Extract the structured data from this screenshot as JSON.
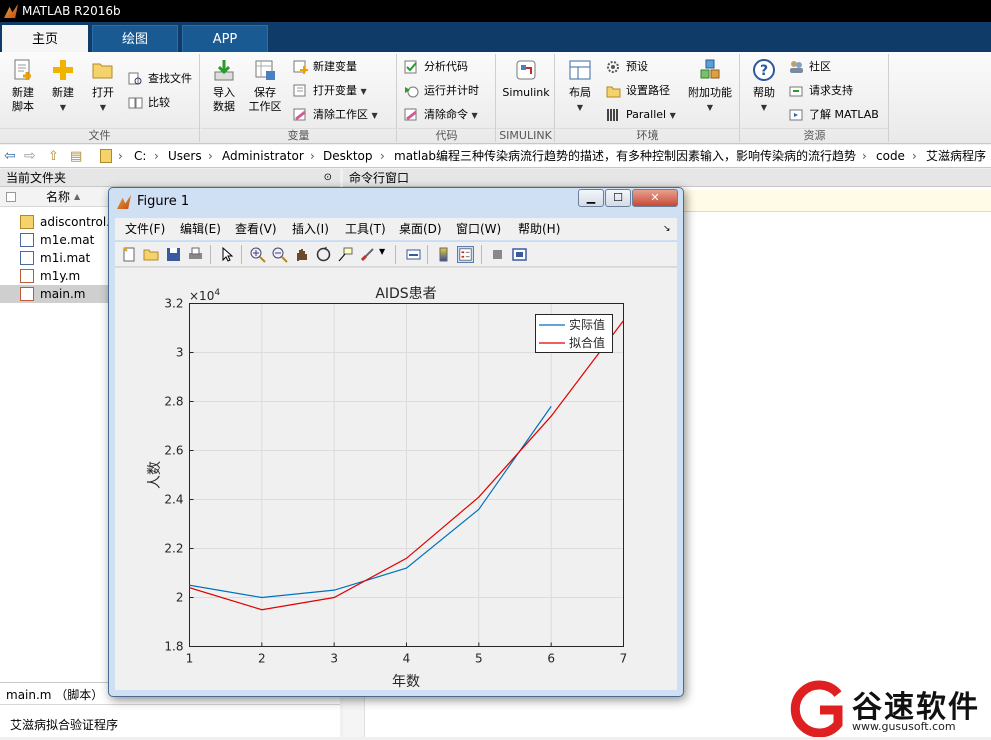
{
  "app": {
    "title": "MATLAB R2016b"
  },
  "tabs": [
    {
      "label": "主页"
    },
    {
      "label": "绘图"
    },
    {
      "label": "APP"
    }
  ],
  "ribbon": {
    "file": {
      "label": "文件",
      "new_script": "新建\n脚本",
      "new_script_l1": "新建",
      "new_script_l2": "脚本",
      "new": "新建",
      "open": "打开",
      "find_files": "查找文件",
      "compare": "比较"
    },
    "variable": {
      "label": "变量",
      "import_l1": "导入",
      "import_l2": "数据",
      "save_l1": "保存",
      "save_l2": "工作区",
      "new_var": "新建变量",
      "open_var": "打开变量",
      "clear_ws": "清除工作区"
    },
    "code": {
      "label": "代码",
      "analyze": "分析代码",
      "run_time": "运行并计时",
      "clear_cmd": "清除命令"
    },
    "simulink": {
      "label": "SIMULINK",
      "btn": "Simulink"
    },
    "env": {
      "label": "环境",
      "layout": "布局",
      "prefs": "预设",
      "set_path": "设置路径",
      "parallel": "Parallel",
      "addons": "附加功能"
    },
    "resources": {
      "label": "资源",
      "help": "帮助",
      "community": "社区",
      "support": "请求支持",
      "learn": "了解 MATLAB"
    }
  },
  "address": {
    "segments": [
      "C:",
      "Users",
      "Administrator",
      "Desktop",
      "matlab编程三种传染病流行趋势的描述，有多种控制因素输入，影响传染病的流行趋势",
      "code",
      "艾滋病程序"
    ]
  },
  "current_folder": {
    "title": "当前文件夹",
    "column": "名称",
    "files": [
      {
        "name": "adiscontrol.",
        "kind": "folder"
      },
      {
        "name": "m1e.mat",
        "kind": "mat"
      },
      {
        "name": "m1i.mat",
        "kind": "mat"
      },
      {
        "name": "m1y.m",
        "kind": "m"
      },
      {
        "name": "main.m",
        "kind": "m"
      }
    ],
    "detail_title": "main.m （脚本）",
    "detail_desc": "艾滋病拟合验证程序"
  },
  "command_window": {
    "title": "命令行窗口"
  },
  "figure": {
    "title": "Figure 1",
    "menu": [
      "文件(F)",
      "编辑(E)",
      "查看(V)",
      "插入(I)",
      "工具(T)",
      "桌面(D)",
      "窗口(W)",
      "帮助(H)"
    ]
  },
  "chart_data": {
    "type": "line",
    "title": "AIDS患者",
    "xlabel": "年数",
    "ylabel": "人数",
    "exponent_label": "×10",
    "exponent_power": "4",
    "xlim": [
      1,
      7
    ],
    "ylim": [
      1.8,
      3.2
    ],
    "xticks": [
      "1",
      "2",
      "3",
      "4",
      "5",
      "6",
      "7"
    ],
    "yticks": [
      "1.8",
      "2",
      "2.2",
      "2.4",
      "2.6",
      "2.8",
      "3",
      "3.2"
    ],
    "grid": true,
    "legend_position": "top-right",
    "series": [
      {
        "name": "实际值",
        "color": "#0072bd",
        "x": [
          1,
          2,
          3,
          4,
          5,
          6
        ],
        "y": [
          2.05,
          2.0,
          2.03,
          2.12,
          2.36,
          2.78
        ]
      },
      {
        "name": "拟合值",
        "color": "#e00000",
        "x": [
          1,
          2,
          3,
          4,
          5,
          6,
          7
        ],
        "y": [
          2.04,
          1.95,
          2.0,
          2.16,
          2.41,
          2.74,
          3.13
        ]
      }
    ]
  },
  "watermark": {
    "text": "谷速软件",
    "url": "www.gususoft.com"
  }
}
